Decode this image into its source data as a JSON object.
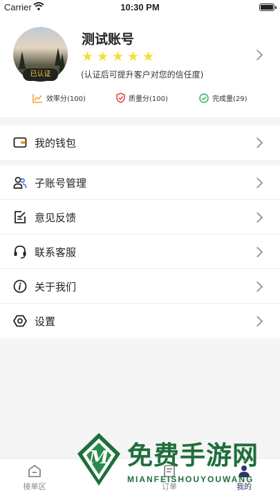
{
  "status_bar": {
    "carrier": "Carrier",
    "time": "10:30 PM"
  },
  "profile": {
    "name": "测试账号",
    "verified_badge": "已认证",
    "stars": 5,
    "hint": "(认证后可提升客户对您的信任度)",
    "metrics": [
      {
        "label": "效率分(100)",
        "icon": "trend-chart-icon",
        "color": "#f0a030"
      },
      {
        "label": "质量分(100)",
        "icon": "shield-check-icon",
        "color": "#e0443c"
      },
      {
        "label": "完成量(29)",
        "icon": "check-circle-icon",
        "color": "#2fb35c"
      }
    ]
  },
  "menu": {
    "wallet": {
      "label": "我的钱包",
      "icon": "wallet-icon"
    },
    "items": [
      {
        "label": "子账号管理",
        "icon": "users-icon"
      },
      {
        "label": "意见反馈",
        "icon": "feedback-edit-icon"
      },
      {
        "label": "联系客服",
        "icon": "headset-icon"
      },
      {
        "label": "关于我们",
        "icon": "info-icon"
      },
      {
        "label": "设置",
        "icon": "settings-icon"
      }
    ]
  },
  "tab_bar": {
    "tabs": [
      {
        "label": "接单区",
        "icon": "home-icon",
        "active": false
      },
      {
        "label": "订单",
        "icon": "order-icon",
        "active": false
      },
      {
        "label": "我的",
        "icon": "user-icon",
        "active": true
      }
    ]
  },
  "watermark": {
    "title": "免费手游网",
    "subtitle": "MIANFEISHOUYOUWANG",
    "logo_letter": "M"
  },
  "colors": {
    "accent": "#2d3470",
    "star": "#f3df35",
    "watermark": "#1f6e3b"
  }
}
